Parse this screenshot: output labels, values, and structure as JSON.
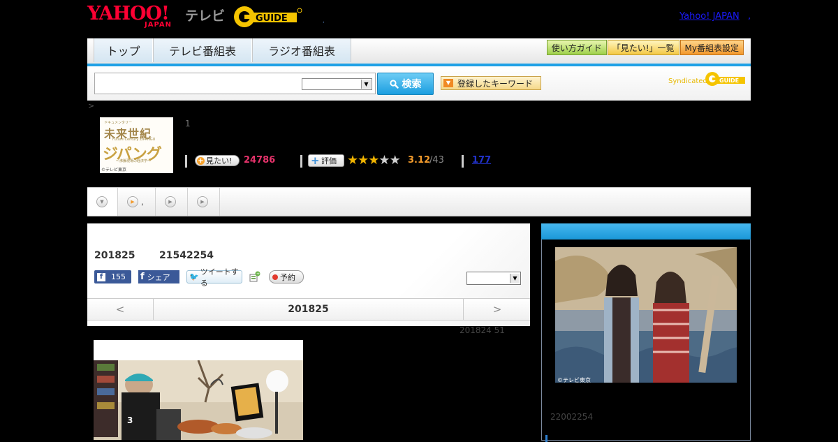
{
  "header": {
    "yahoo_logo": "YAHOO!",
    "yahoo_japan": "JAPAN",
    "tv_label": "テレビ",
    "gguide_logo": "G-GUIDE",
    "yahoo_japan_link": "Yahoo! JAPAN",
    "link_sep": ",",
    "mark": ","
  },
  "nav": {
    "tabs": [
      "トップ",
      "テレビ番組表",
      "ラジオ番組表"
    ],
    "buttons": [
      "使い方ガイド",
      "「見たい!」一覧",
      "My番組表設定"
    ]
  },
  "search": {
    "input_value": "",
    "select_value": "",
    "button_label": "検索",
    "keyword_button": "登録したキーワード",
    "syndicated_label": "Syndicated"
  },
  "breadcrumb": ">",
  "program": {
    "thumb_caption": "ドキュメンタリー",
    "thumb_title_1": "未来世紀",
    "thumb_sub": "Future Century ZIPANGU",
    "thumb_title_2": "ジパング",
    "thumb_tag": "〜沸騰現場の経済学〜",
    "thumb_copyright": "©テレビ東京",
    "title": "1",
    "mitai_label": "見たい!",
    "mitai_count": "24786",
    "rate_label": "評価",
    "rating_stars": 3,
    "rating_max": 5,
    "rating_value": "3.12",
    "rating_count": "/43",
    "reviews_count": "177"
  },
  "tabstrip": {
    "items": [
      "",
      ",",
      "",
      ""
    ]
  },
  "episode": {
    "date": "201825",
    "time": "21542254",
    "fb_like_count": "155",
    "fb_share_label": "シェア",
    "tweet_label": "ツイートする",
    "reserve_label": "予約",
    "select_value": "",
    "prev": "<",
    "nav_date": "201825",
    "next": ">",
    "updated": "201824  51"
  },
  "side": {
    "photo_copyright": "©テレビ東京",
    "time": "22002254"
  },
  "colors": {
    "accent_blue": "#1fa1e6",
    "mitai_pink": "#e6336b",
    "rating_orange": "#f29b2c",
    "yahoo_red": "#ff0033"
  }
}
